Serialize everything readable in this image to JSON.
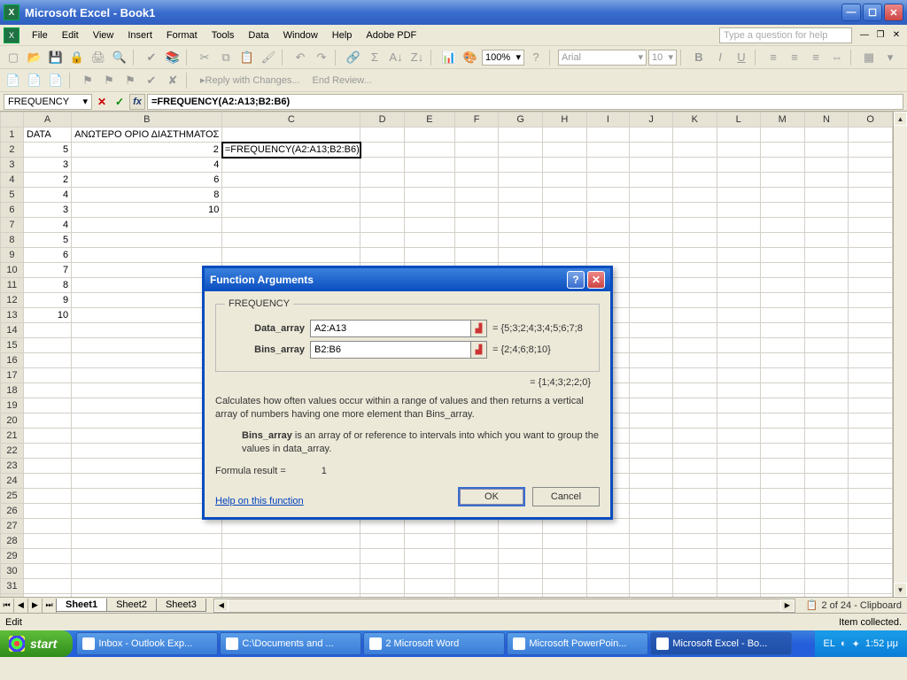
{
  "titlebar": {
    "title": "Microsoft Excel - Book1"
  },
  "menubar": {
    "items": [
      "File",
      "Edit",
      "View",
      "Insert",
      "Format",
      "Tools",
      "Data",
      "Window",
      "Help",
      "Adobe PDF"
    ],
    "help_placeholder": "Type a question for help"
  },
  "toolbar": {
    "zoom": "100%",
    "font": "Arial",
    "fontsize": "10",
    "reply_label": "Reply with Changes...",
    "end_review_label": "End Review..."
  },
  "formulabar": {
    "namebox_value": "FREQUENCY",
    "formula": "=FREQUENCY(A2:A13;B2:B6)"
  },
  "grid": {
    "cols": [
      "A",
      "B",
      "C",
      "D",
      "E",
      "F",
      "G",
      "H",
      "I",
      "J",
      "K",
      "L",
      "M",
      "N",
      "O"
    ],
    "row1": {
      "A": "DATA",
      "B_span": "ΑΝΩΤΕΡΟ ΟΡΙΟ ΔΙΑΣΤΗΜΑΤΟΣ"
    },
    "data_rows": [
      {
        "r": 2,
        "A": "5",
        "B": "2",
        "C": "=FREQUENCY(A2:A13;B2:B6)"
      },
      {
        "r": 3,
        "A": "3",
        "B": "4"
      },
      {
        "r": 4,
        "A": "2",
        "B": "6"
      },
      {
        "r": 5,
        "A": "4",
        "B": "8"
      },
      {
        "r": 6,
        "A": "3",
        "B": "10"
      },
      {
        "r": 7,
        "A": "4"
      },
      {
        "r": 8,
        "A": "5"
      },
      {
        "r": 9,
        "A": "6"
      },
      {
        "r": 10,
        "A": "7"
      },
      {
        "r": 11,
        "A": "8"
      },
      {
        "r": 12,
        "A": "9"
      },
      {
        "r": 13,
        "A": "10"
      }
    ]
  },
  "dialog": {
    "title": "Function Arguments",
    "function_name": "FREQUENCY",
    "args": [
      {
        "label": "Data_array",
        "value": "A2:A13",
        "preview": "= {5;3;2;4;3;4;5;6;7;8"
      },
      {
        "label": "Bins_array",
        "value": "B2:B6",
        "preview": "= {2;4;6;8;10}"
      }
    ],
    "result_preview": "= {1;4;3;2;2;0}",
    "description": "Calculates how often values occur within a range of values and then returns a vertical array of numbers having one more element than Bins_array.",
    "arg_help_label": "Bins_array",
    "arg_help_text": " is an array of or reference to intervals into which you want to group the values in data_array.",
    "formula_result_label": "Formula result =",
    "formula_result_value": "1",
    "help_link": "Help on this function",
    "ok": "OK",
    "cancel": "Cancel"
  },
  "sheettabs": {
    "tabs": [
      "Sheet1",
      "Sheet2",
      "Sheet3"
    ],
    "active": 0,
    "clipboard_label": "2 of 24 - Clipboard"
  },
  "statusbar": {
    "left": "Edit",
    "right": "Item collected."
  },
  "taskbar": {
    "start": "start",
    "tasks": [
      {
        "label": "Inbox - Outlook Exp..."
      },
      {
        "label": "C:\\Documents and ..."
      },
      {
        "label": "2 Microsoft Word"
      },
      {
        "label": "Microsoft PowerPoin..."
      },
      {
        "label": "Microsoft Excel - Bo...",
        "active": true
      }
    ],
    "lang": "EL",
    "clock": "1:52 μμ"
  }
}
